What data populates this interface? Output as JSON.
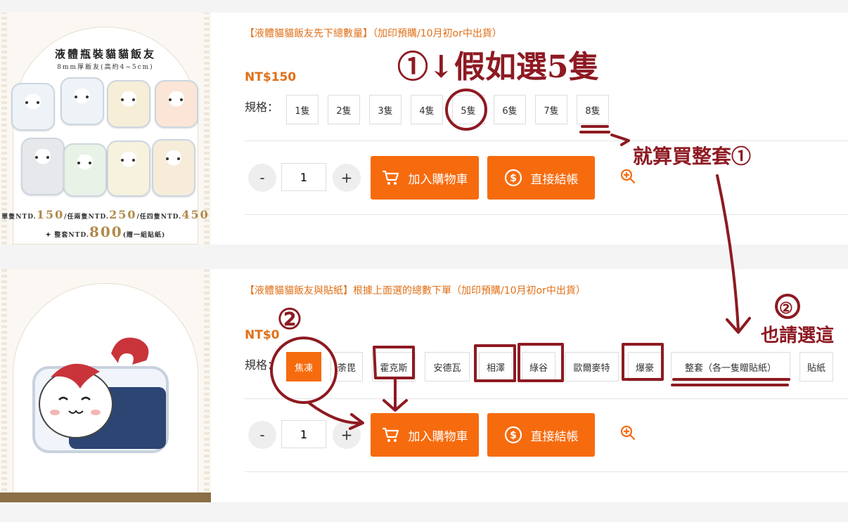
{
  "colors": {
    "accent": "#f66b0e",
    "title_orange": "#e07018",
    "annotation_red": "#8e1a22"
  },
  "product1": {
    "title": "【液體貓貓飯友先下總數量】（加印預購/10月初or中出貨）",
    "price": "NT$150",
    "spec_label": "規格：",
    "options": [
      "1隻",
      "2隻",
      "3隻",
      "4隻",
      "5隻",
      "6隻",
      "7隻",
      "8隻"
    ],
    "qty": "1",
    "minus": "-",
    "plus": "+",
    "add_to_cart": "加入購物車",
    "checkout": "直接結帳",
    "image": {
      "title": "液體瓶裝貓貓飯友",
      "subtitle": "8mm厚飯友(高約4~5cm)",
      "price_line1_a": "單隻NTD.",
      "price_line1_b": "150",
      "price_line1_c": "/任兩隻NTD.",
      "price_line1_d": "250",
      "price_line1_e": "/任四隻NTD.",
      "price_line1_f": "450",
      "price_line2_a": "整套NTD.",
      "price_line2_b": "800",
      "price_line2_c": "(贈一組貼紙)"
    }
  },
  "product2": {
    "title": "【液體貓貓飯友與貼紙】根據上面選的總數下單（加印預購/10月初or中出貨）",
    "price": "NT$0",
    "spec_label": "規格：",
    "options": [
      "焦凍",
      "荼毘",
      "霍克斯",
      "安德瓦",
      "相澤",
      "綠谷",
      "歐爾麥特",
      "爆豪",
      "整套（各一隻贈貼紙）",
      "貼紙"
    ],
    "selected_index": 0,
    "qty": "1",
    "minus": "-",
    "plus": "+",
    "add_to_cart": "加入購物車",
    "checkout": "直接結帳"
  },
  "annotations": {
    "note1": "①↓假如選5隻",
    "note2": "就算買整套①",
    "note3_circle": "②",
    "note3_text": "也請選這",
    "note4": "②"
  }
}
